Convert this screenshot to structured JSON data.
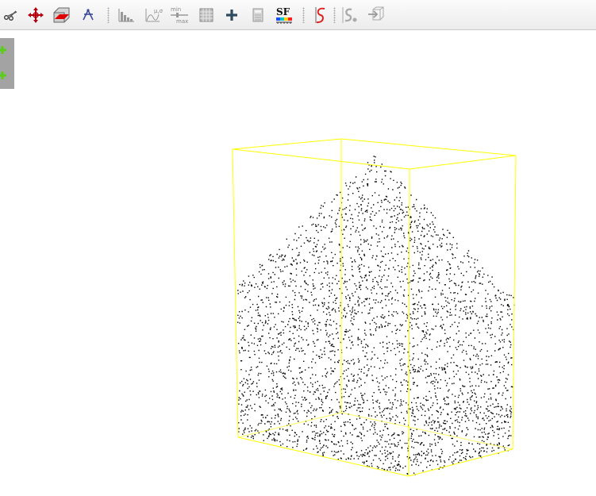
{
  "toolbar": {
    "tools": [
      {
        "id": "scissors",
        "icon": "scissors-icon"
      },
      {
        "id": "translate-rotate",
        "icon": "move-arrows-icon"
      },
      {
        "id": "cross-section",
        "icon": "cross-section-box-icon"
      },
      {
        "id": "point-picking",
        "icon": "point-pick-icon"
      },
      {
        "id": "histogram",
        "icon": "histogram-icon"
      },
      {
        "id": "distribution-fit",
        "icon": "mu-sigma-fit-icon"
      },
      {
        "id": "filter-by-value",
        "icon": "min-max-filter-icon"
      },
      {
        "id": "scalar-field-gradient",
        "icon": "grid-icon"
      },
      {
        "id": "add-constant",
        "icon": "plus-icon"
      },
      {
        "id": "calculator",
        "icon": "calculator-icon"
      },
      {
        "id": "scalar-field",
        "icon": "sf-colorscale-icon",
        "label": "SF"
      },
      {
        "id": "sf-curve",
        "icon": "red-s-curve-icon"
      },
      {
        "id": "subsample",
        "icon": "gray-s-dots-icon"
      },
      {
        "id": "export",
        "icon": "export-box-icon"
      }
    ]
  },
  "side_panel": {
    "items": [
      {
        "icon": "green-plus-icon"
      },
      {
        "icon": "green-plus-icon"
      }
    ]
  },
  "scene": {
    "bbox_color": "#ffff00",
    "point_color": "#000000",
    "background": "#ffffff"
  }
}
